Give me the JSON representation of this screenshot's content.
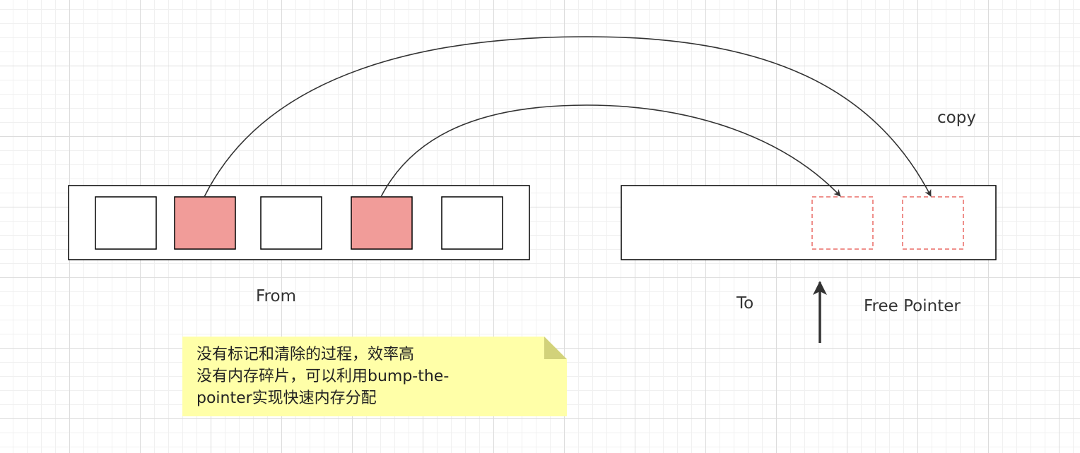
{
  "labels": {
    "from": "From",
    "to": "To",
    "free_pointer": "Free Pointer",
    "copy": "copy"
  },
  "note": {
    "lines": [
      "没有标记和清除的过程，效率高",
      "没有内存碎片，可以利用bump-the-",
      "pointer实现快速内存分配"
    ]
  },
  "from_space": {
    "cells": [
      {
        "live": false
      },
      {
        "live": true
      },
      {
        "live": false
      },
      {
        "live": true
      },
      {
        "live": false
      }
    ]
  },
  "colors": {
    "live_fill": "#F19C99",
    "copied_border": "#EA6B66",
    "note_fill": "#FFFFA8",
    "note_fold": "#D2D27A",
    "line": "#333333"
  }
}
